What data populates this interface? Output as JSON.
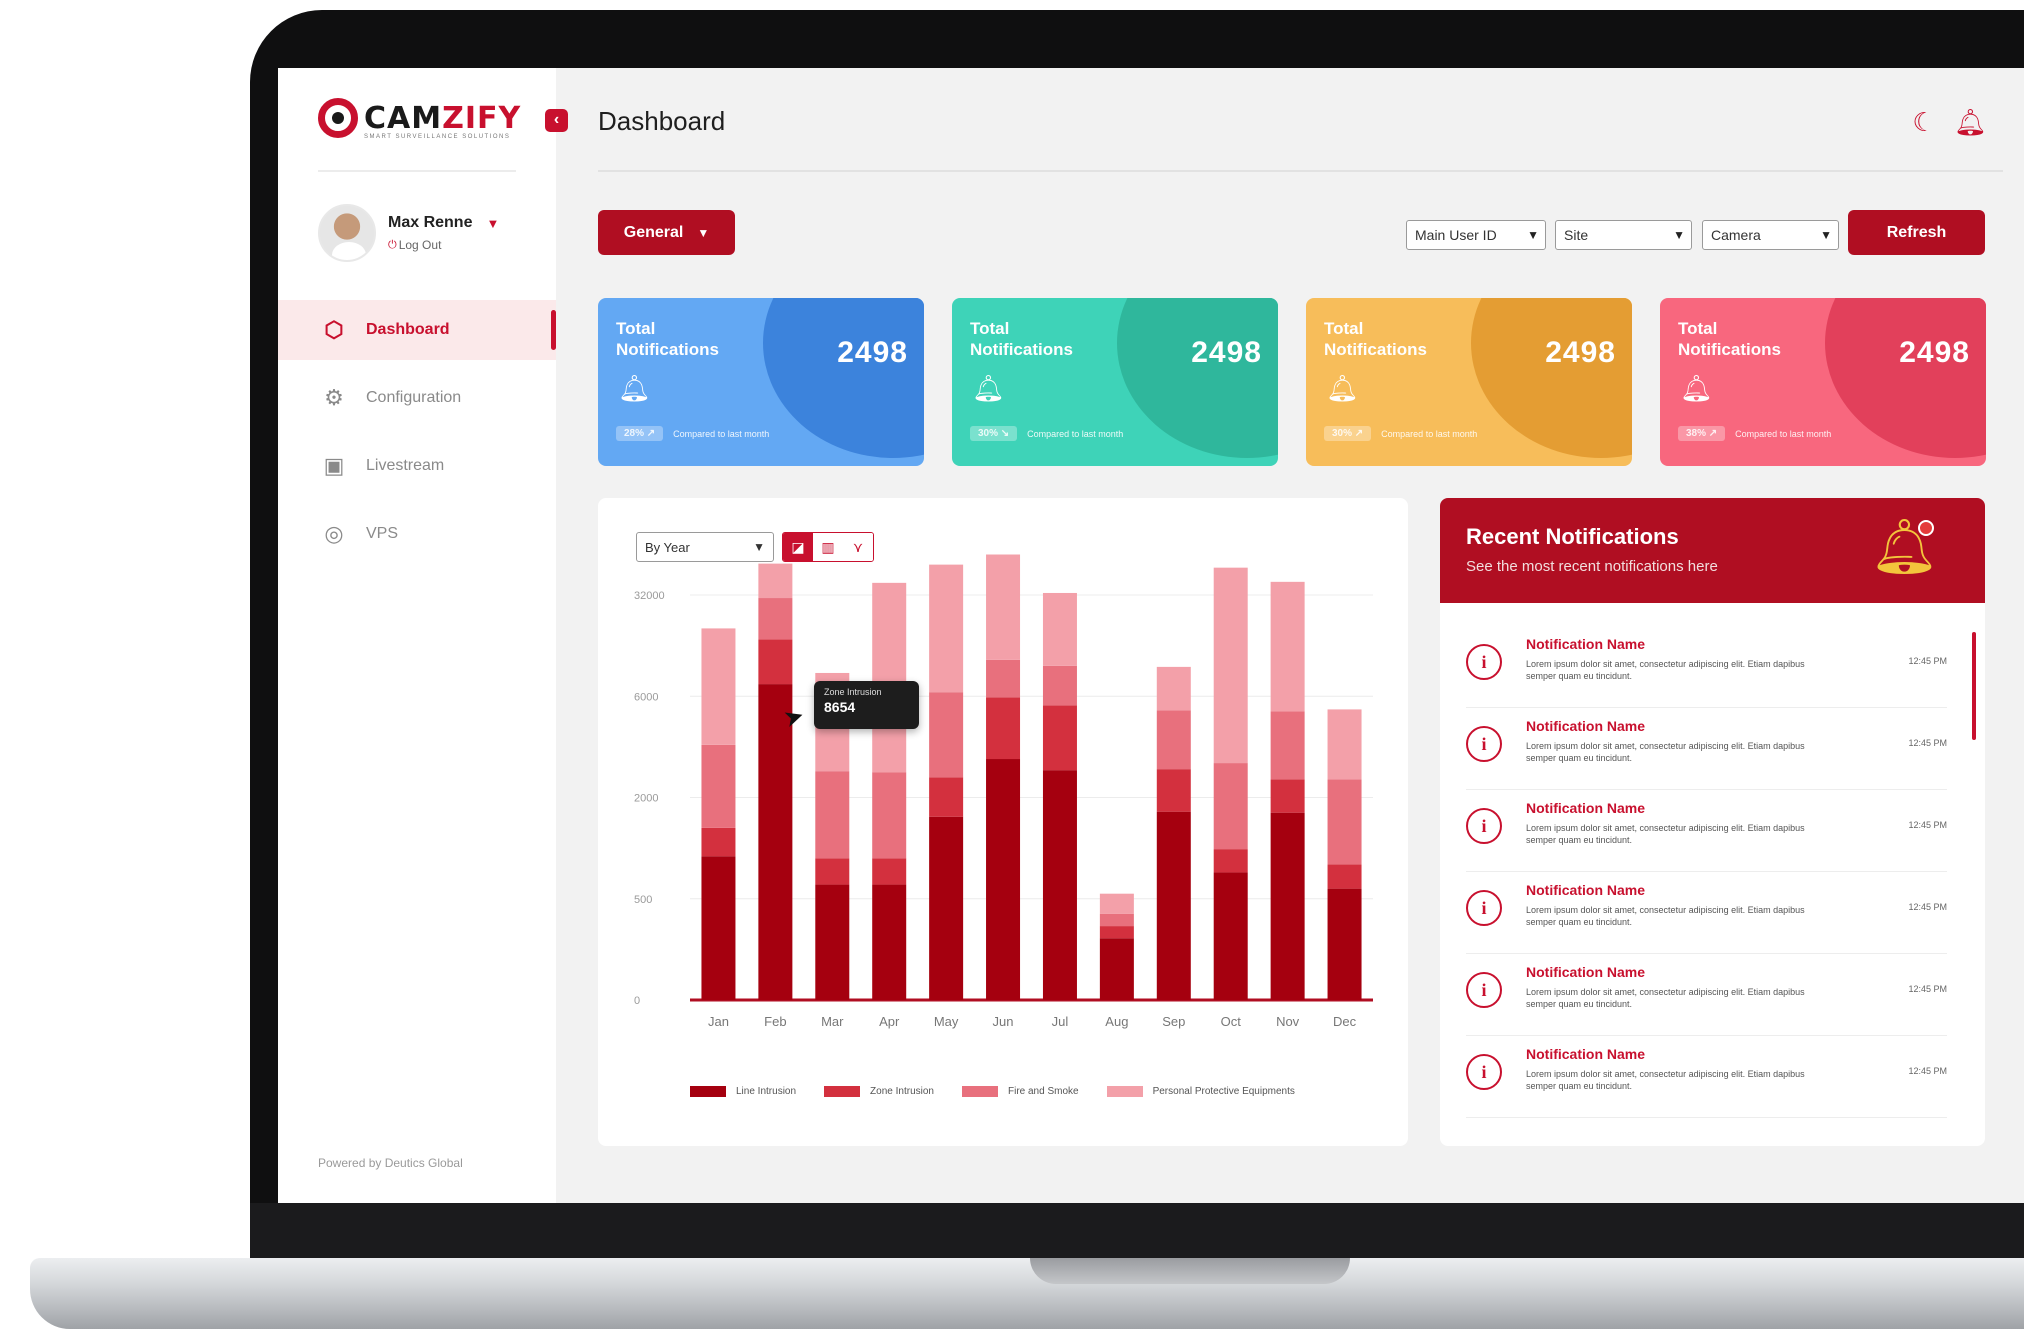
{
  "app": {
    "brand_a": "CAM",
    "brand_b": "ZIFY",
    "tagline": "SMART SURVEILLANCE SOLUTIONS",
    "powered_by": "Powered by Deutics Global",
    "page_title": "Dashboard"
  },
  "user": {
    "name": "Max Renne",
    "logout": "Log Out"
  },
  "sidebar": {
    "items": [
      {
        "label": "Dashboard",
        "icon": "hexagon-icon"
      },
      {
        "label": "Configuration",
        "icon": "settings-icon"
      },
      {
        "label": "Livestream",
        "icon": "monitor-icon"
      },
      {
        "label": "VPS",
        "icon": "target-icon"
      }
    ]
  },
  "toolbar": {
    "general_label": "General",
    "filters": [
      "Main User ID",
      "Site",
      "Camera"
    ],
    "refresh_label": "Refresh"
  },
  "cards": [
    {
      "title": "Total Notifications",
      "value": "2498",
      "badge": "28% ↗",
      "note": "Compared to last month",
      "color": "#63a8f3",
      "blob": "#3c83dc"
    },
    {
      "title": "Total Notifications",
      "value": "2498",
      "badge": "30% ↘",
      "note": "Compared to last month",
      "color": "#3ed3b8",
      "blob": "#2fb79c"
    },
    {
      "title": "Total Notifications",
      "value": "2498",
      "badge": "30% ↗",
      "note": "Compared to last month",
      "color": "#f7bd5a",
      "blob": "#e49d33"
    },
    {
      "title": "Total Notifications",
      "value": "2498",
      "badge": "38% ↗",
      "note": "Compared to last month",
      "color": "#f8677e",
      "blob": "#e2405b"
    }
  ],
  "chart_controls": {
    "period": "By Year"
  },
  "chart_data": {
    "type": "bar",
    "stacked": true,
    "categories": [
      "Jan",
      "Feb",
      "Mar",
      "Apr",
      "May",
      "Jun",
      "Jul",
      "Aug",
      "Sep",
      "Oct",
      "Nov",
      "Dec"
    ],
    "y_ticks": [
      "0",
      "500",
      "2000",
      "6000",
      "32000"
    ],
    "series": [
      {
        "name": "Line Intrusion",
        "color": "#a5000f",
        "values": [
          1.42,
          3.12,
          1.14,
          1.14,
          1.81,
          2.38,
          2.27,
          0.61,
          1.86,
          1.26,
          1.85,
          1.1
        ]
      },
      {
        "name": "Zone Intrusion",
        "color": "#d3303e",
        "values": [
          0.28,
          0.44,
          0.26,
          0.26,
          0.39,
          0.61,
          0.64,
          0.12,
          0.42,
          0.23,
          0.33,
          0.24
        ]
      },
      {
        "name": "Fire and Smoke",
        "color": "#e8707d",
        "values": [
          0.82,
          0.41,
          0.86,
          0.85,
          0.84,
          0.37,
          0.39,
          0.12,
          0.58,
          0.85,
          0.67,
          0.84
        ]
      },
      {
        "name": "Personal Protective Equipments",
        "color": "#f3a0a9",
        "values": [
          1.15,
          0.34,
          0.97,
          1.87,
          1.26,
          1.04,
          0.72,
          0.2,
          0.43,
          1.93,
          1.28,
          0.69
        ]
      }
    ],
    "tooltip": {
      "label": "Zone Intrusion",
      "value": "8654"
    }
  },
  "notifications": {
    "title": "Recent Notifications",
    "subtitle": "See the most recent notifications here",
    "items": [
      {
        "name": "Notification Name",
        "body": "Lorem ipsum dolor sit amet, consectetur adipiscing elit. Etiam dapibus semper quam eu tincidunt.",
        "time": "12:45 PM"
      },
      {
        "name": "Notification Name",
        "body": "Lorem ipsum dolor sit amet, consectetur adipiscing elit. Etiam dapibus semper quam eu tincidunt.",
        "time": "12:45 PM"
      },
      {
        "name": "Notification Name",
        "body": "Lorem ipsum dolor sit amet, consectetur adipiscing elit. Etiam dapibus semper quam eu tincidunt.",
        "time": "12:45 PM"
      },
      {
        "name": "Notification Name",
        "body": "Lorem ipsum dolor sit amet, consectetur adipiscing elit. Etiam dapibus semper quam eu tincidunt.",
        "time": "12:45 PM"
      },
      {
        "name": "Notification Name",
        "body": "Lorem ipsum dolor sit amet, consectetur adipiscing elit. Etiam dapibus semper quam eu tincidunt.",
        "time": "12:45 PM"
      },
      {
        "name": "Notification Name",
        "body": "Lorem ipsum dolor sit amet, consectetur adipiscing elit. Etiam dapibus semper quam eu tincidunt.",
        "time": "12:45 PM"
      }
    ]
  }
}
